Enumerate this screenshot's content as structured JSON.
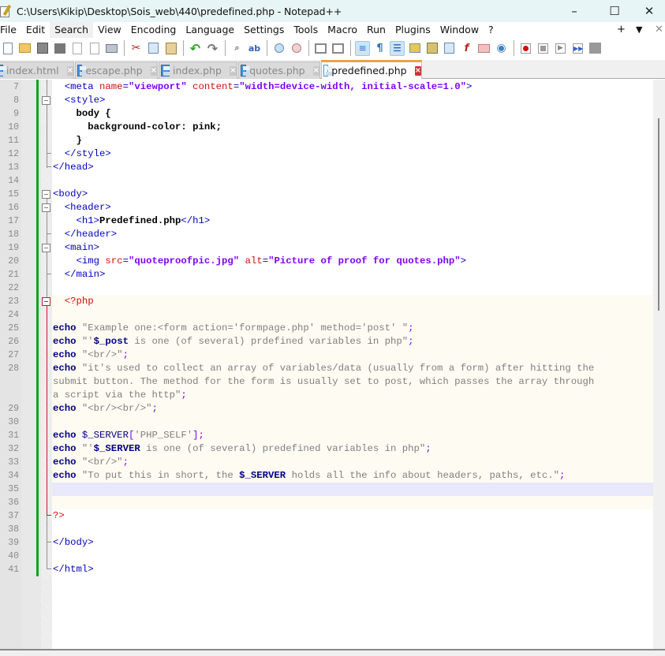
{
  "window": {
    "title": "C:\\Users\\Kikip\\Desktop\\Sois_web\\440\\predefined.php - Notepad++",
    "controls": {
      "minimize": "–",
      "maximize": "☐",
      "close": "✕"
    }
  },
  "menu": {
    "items": [
      "File",
      "Edit",
      "Search",
      "View",
      "Encoding",
      "Language",
      "Settings",
      "Tools",
      "Macro",
      "Run",
      "Plugins",
      "Window",
      "?"
    ],
    "right": {
      "add": "+",
      "dropdown": "▼",
      "close": "✕"
    }
  },
  "toolbar": {
    "icons": [
      "new-file-icon",
      "open-file-icon",
      "save-icon",
      "save-all-icon",
      "close-icon",
      "close-all-icon",
      "print-icon",
      "cut-icon",
      "copy-icon",
      "paste-icon",
      "undo-icon",
      "redo-icon",
      "find-icon",
      "replace-icon",
      "zoom-in-icon",
      "zoom-out-icon",
      "sync-vertical-icon",
      "sync-horizontal-icon",
      "word-wrap-icon",
      "show-all-chars-icon",
      "indent-guide-icon",
      "user-lang-icon",
      "document-map-icon",
      "document-list-icon",
      "function-list-icon",
      "folder-workspace-icon",
      "monitoring-icon",
      "record-macro-icon",
      "stop-macro-icon",
      "play-macro-icon",
      "run-macro-multiple-icon",
      "save-macro-icon"
    ]
  },
  "tabs": [
    {
      "label": "index.html",
      "active": false
    },
    {
      "label": "escape.php",
      "active": false
    },
    {
      "label": "index.php",
      "active": false
    },
    {
      "label": "quotes.php",
      "active": false
    },
    {
      "label": "predefined.php",
      "active": true
    }
  ],
  "editor": {
    "lines": [
      {
        "n": "7",
        "tokens": [
          [
            "t-tag",
            "  <meta "
          ],
          [
            "t-attr",
            "name"
          ],
          [
            "t-tag",
            "="
          ],
          [
            "t-val",
            "\"viewport\""
          ],
          [
            "t-tag",
            " "
          ],
          [
            "t-attr",
            "content"
          ],
          [
            "t-tag",
            "="
          ],
          [
            "t-val",
            "\"width=device-width, initial-scale=1.0\""
          ],
          [
            "t-tag",
            ">"
          ]
        ]
      },
      {
        "n": "8",
        "tokens": [
          [
            "t-tag",
            "  <style>"
          ]
        ]
      },
      {
        "n": "9",
        "tokens": [
          [
            "t-css",
            "    body {"
          ]
        ]
      },
      {
        "n": "10",
        "tokens": [
          [
            "t-css",
            "      background-color: pink;"
          ]
        ]
      },
      {
        "n": "11",
        "tokens": [
          [
            "t-css",
            "    }"
          ]
        ]
      },
      {
        "n": "12",
        "tokens": [
          [
            "t-tag",
            "  </style>"
          ]
        ]
      },
      {
        "n": "13",
        "tokens": [
          [
            "t-tag",
            "</head>"
          ]
        ]
      },
      {
        "n": "14",
        "tokens": []
      },
      {
        "n": "15",
        "tokens": [
          [
            "t-tag",
            "<body>"
          ]
        ]
      },
      {
        "n": "16",
        "tokens": [
          [
            "t-tag",
            "  <header>"
          ]
        ]
      },
      {
        "n": "17",
        "tokens": [
          [
            "t-tag",
            "    <h1>"
          ],
          [
            "t-text",
            "Predefined.php"
          ],
          [
            "t-tag",
            "</h1>"
          ]
        ]
      },
      {
        "n": "18",
        "tokens": [
          [
            "t-tag",
            "  </header>"
          ]
        ]
      },
      {
        "n": "19",
        "tokens": [
          [
            "t-tag",
            "  <main>"
          ]
        ]
      },
      {
        "n": "20",
        "tokens": [
          [
            "t-tag",
            "    <img "
          ],
          [
            "t-attr",
            "src"
          ],
          [
            "t-tag",
            "="
          ],
          [
            "t-val",
            "\"quoteproofpic.jpg\""
          ],
          [
            "t-tag",
            " "
          ],
          [
            "t-attr",
            "alt"
          ],
          [
            "t-tag",
            "="
          ],
          [
            "t-val",
            "\"Picture of proof for quotes.php\""
          ],
          [
            "t-tag",
            ">"
          ]
        ]
      },
      {
        "n": "21",
        "tokens": [
          [
            "t-tag",
            "  </main>"
          ]
        ]
      },
      {
        "n": "22",
        "tokens": []
      },
      {
        "n": "23",
        "tokens": [
          [
            "t-php",
            "  <?php"
          ]
        ]
      },
      {
        "n": "24",
        "tokens": []
      },
      {
        "n": "25",
        "tokens": [
          [
            "t-kw",
            "echo"
          ],
          [
            "t-str",
            " \"Example one:<form action='formpage.php' method='post' \""
          ],
          [
            "t-op",
            ";"
          ]
        ]
      },
      {
        "n": "26",
        "tokens": [
          [
            "t-kw",
            "echo"
          ],
          [
            "t-str",
            " \"'"
          ],
          [
            "t-kw",
            "$_post"
          ],
          [
            "t-str",
            " is one (of several) prdefined variables in php\""
          ],
          [
            "t-op",
            ";"
          ]
        ]
      },
      {
        "n": "27",
        "tokens": [
          [
            "t-kw",
            "echo"
          ],
          [
            "t-str",
            " \"<br/>\""
          ],
          [
            "t-op",
            ";"
          ]
        ]
      },
      {
        "n": "28",
        "tokens": [
          [
            "t-kw",
            "echo"
          ],
          [
            "t-str",
            " \"it's used to collect an array of variables/data (usually from a form) after hitting the"
          ]
        ]
      },
      {
        "n": "",
        "tokens": [
          [
            "t-str",
            "submit button. The method for the form is usually set to post, which passes the array through"
          ]
        ]
      },
      {
        "n": "",
        "tokens": [
          [
            "t-str",
            "a script via the http\""
          ],
          [
            "t-op",
            ";"
          ]
        ]
      },
      {
        "n": "29",
        "tokens": [
          [
            "t-kw",
            "echo"
          ],
          [
            "t-str",
            " \"<br/><br/>\""
          ],
          [
            "t-op",
            ";"
          ]
        ]
      },
      {
        "n": "30",
        "tokens": []
      },
      {
        "n": "31",
        "tokens": [
          [
            "t-kw",
            "echo"
          ],
          [
            "t-var",
            " $_SERVER"
          ],
          [
            "t-op",
            "["
          ],
          [
            "t-str",
            "'PHP_SELF'"
          ],
          [
            "t-op",
            "];"
          ]
        ]
      },
      {
        "n": "32",
        "tokens": [
          [
            "t-kw",
            "echo"
          ],
          [
            "t-str",
            " \"'"
          ],
          [
            "t-kw",
            "$_SERVER"
          ],
          [
            "t-str",
            " is one (of several) predefined variables in php\""
          ],
          [
            "t-op",
            ";"
          ]
        ]
      },
      {
        "n": "33",
        "tokens": [
          [
            "t-kw",
            "echo"
          ],
          [
            "t-str",
            " \"<br/>\""
          ],
          [
            "t-op",
            ";"
          ]
        ]
      },
      {
        "n": "34",
        "tokens": [
          [
            "t-kw",
            "echo"
          ],
          [
            "t-str",
            " \"To put this in short, the "
          ],
          [
            "t-kw",
            "$_SERVER"
          ],
          [
            "t-str",
            " holds all the info about headers, paths, etc.\""
          ],
          [
            "t-op",
            ";"
          ]
        ]
      },
      {
        "n": "35",
        "tokens": []
      },
      {
        "n": "36",
        "tokens": []
      },
      {
        "n": "37",
        "tokens": [
          [
            "t-php",
            "?>"
          ]
        ]
      },
      {
        "n": "38",
        "tokens": []
      },
      {
        "n": "39",
        "tokens": [
          [
            "t-tag",
            "</body>"
          ]
        ]
      },
      {
        "n": "40",
        "tokens": []
      },
      {
        "n": "41",
        "tokens": [
          [
            "t-tag",
            "</html>"
          ]
        ]
      }
    ]
  }
}
